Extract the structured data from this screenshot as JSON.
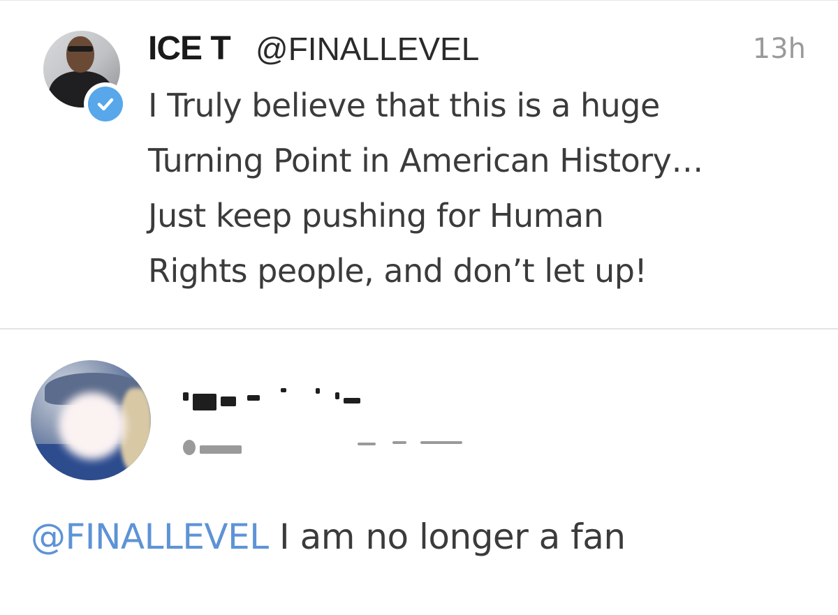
{
  "colors": {
    "verified_badge": "#57a7ea",
    "mention_link": "#5d93d6",
    "timestamp": "#9a9a9a",
    "divider": "#e4e4e4"
  },
  "original_tweet": {
    "display_name": "ICE T",
    "handle": "@FINALLEVEL",
    "time_ago": "13h",
    "verified_icon": "verified-check-icon",
    "text_lines": [
      "I Truly believe that this is a huge",
      "Turning Point in American History…",
      "Just keep pushing for Human",
      "Rights people, and don’t let up!"
    ]
  },
  "reply": {
    "mention": "@FINALLEVEL",
    "text": " I am no longer a fan"
  }
}
